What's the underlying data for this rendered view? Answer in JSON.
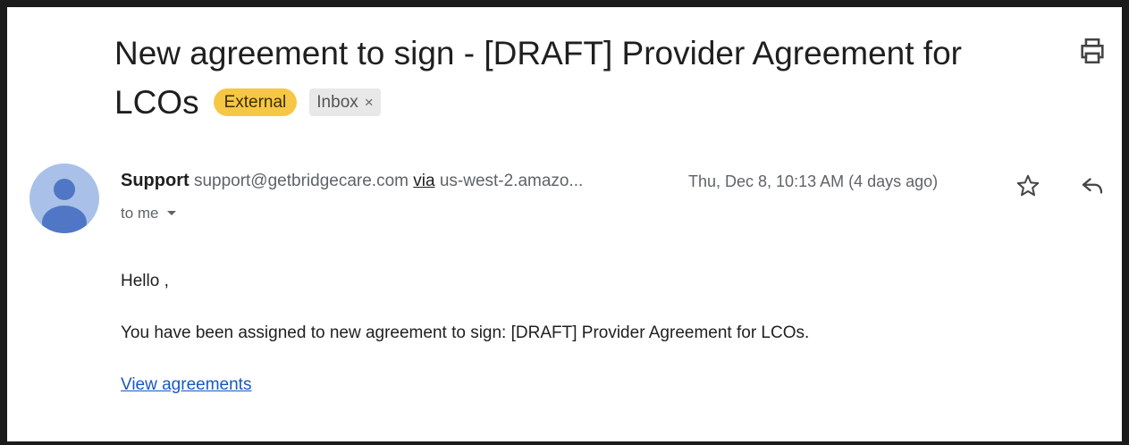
{
  "email": {
    "subject_line1": "New agreement to sign - [DRAFT] Provider Agreement for",
    "subject_line2": "LCOs",
    "labels": {
      "external": "External",
      "inbox": "Inbox",
      "remove_symbol": "×"
    },
    "sender": {
      "name": "Support",
      "address": "support@getbridgecare.com",
      "via_label": "via",
      "via_domain": "us-west-2.amazo..."
    },
    "date": "Thu, Dec 8, 10:13 AM (4 days ago)",
    "recipient": "to me",
    "body": {
      "greeting": "Hello ,",
      "message": "You have been assigned to new agreement to sign: [DRAFT] Provider Agreement for LCOs.",
      "link_text": "View agreements"
    }
  },
  "icons": {
    "print": "print-icon",
    "star": "star-icon",
    "reply": "reply-icon",
    "avatar": "default-person-avatar",
    "caret": "caret-down-icon"
  },
  "colors": {
    "external_chip": "#f6c744",
    "inbox_chip": "#e8e8e8",
    "avatar_bg": "#a9c1e8",
    "avatar_fg": "#4f77c5",
    "link": "#1a56c4"
  }
}
